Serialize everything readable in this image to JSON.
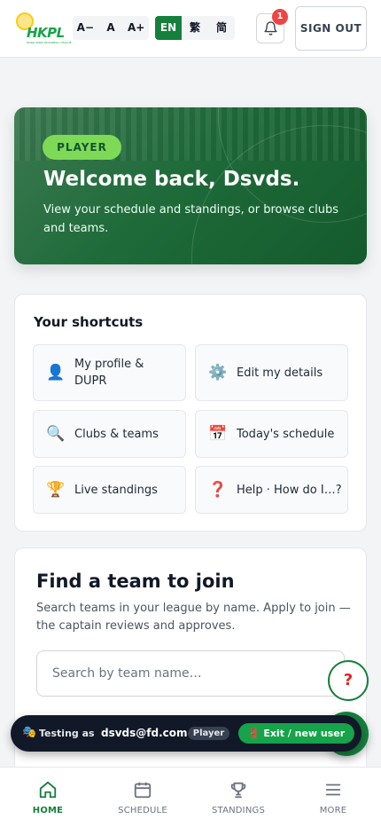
{
  "header": {
    "logo_text": "HKPL",
    "logo_subtitle": "HONG KONG PICKLEBALL LEAGUE",
    "font_size_controls": [
      "A−",
      "A",
      "A+"
    ],
    "language_options": [
      {
        "label": "EN",
        "active": true
      },
      {
        "label": "繁",
        "active": false
      },
      {
        "label": "简",
        "active": false
      }
    ],
    "notification_count": "1",
    "sign_out_label": "SIGN OUT"
  },
  "hero": {
    "role_badge": "PLAYER",
    "welcome": "Welcome back, Dsvds.",
    "subtitle": "View your schedule and standings, or browse clubs and teams."
  },
  "shortcuts": {
    "title": "Your shortcuts",
    "items": [
      {
        "icon": "person-icon",
        "glyph": "👤",
        "label": "My profile & DUPR"
      },
      {
        "icon": "gear-icon",
        "glyph": "⚙️",
        "label": "Edit my details"
      },
      {
        "icon": "magnifier-icon",
        "glyph": "🔍",
        "label": "Clubs & teams"
      },
      {
        "icon": "calendar-icon",
        "glyph": "📅",
        "label": "Today's schedule"
      },
      {
        "icon": "trophy-icon",
        "glyph": "🏆",
        "label": "Live standings"
      },
      {
        "icon": "question-icon",
        "glyph": "❓",
        "label": "Help · How do I…?"
      }
    ]
  },
  "find_team": {
    "title": "Find a team to join",
    "subtitle": "Search teams in your league by name. Apply to join — the captain reviews and approves.",
    "search_placeholder": "Search by team name…"
  },
  "help_fab": "?",
  "testing_bar": {
    "icon_glyph": "🎭",
    "label": "Testing as",
    "email": "dsvds@fd.com",
    "role": "Player",
    "exit_label": "🚪 Exit / new user"
  },
  "bottom_nav": [
    {
      "icon": "home-icon",
      "label": "HOME",
      "active": true
    },
    {
      "icon": "calendar-icon",
      "label": "SCHEDULE",
      "active": false
    },
    {
      "icon": "trophy-icon",
      "label": "STANDINGS",
      "active": false
    },
    {
      "icon": "menu-icon",
      "label": "MORE",
      "active": false
    }
  ],
  "colors": {
    "brand_green": "#15803d",
    "accent_lime": "#7ed957",
    "badge_red": "#ef4444"
  }
}
